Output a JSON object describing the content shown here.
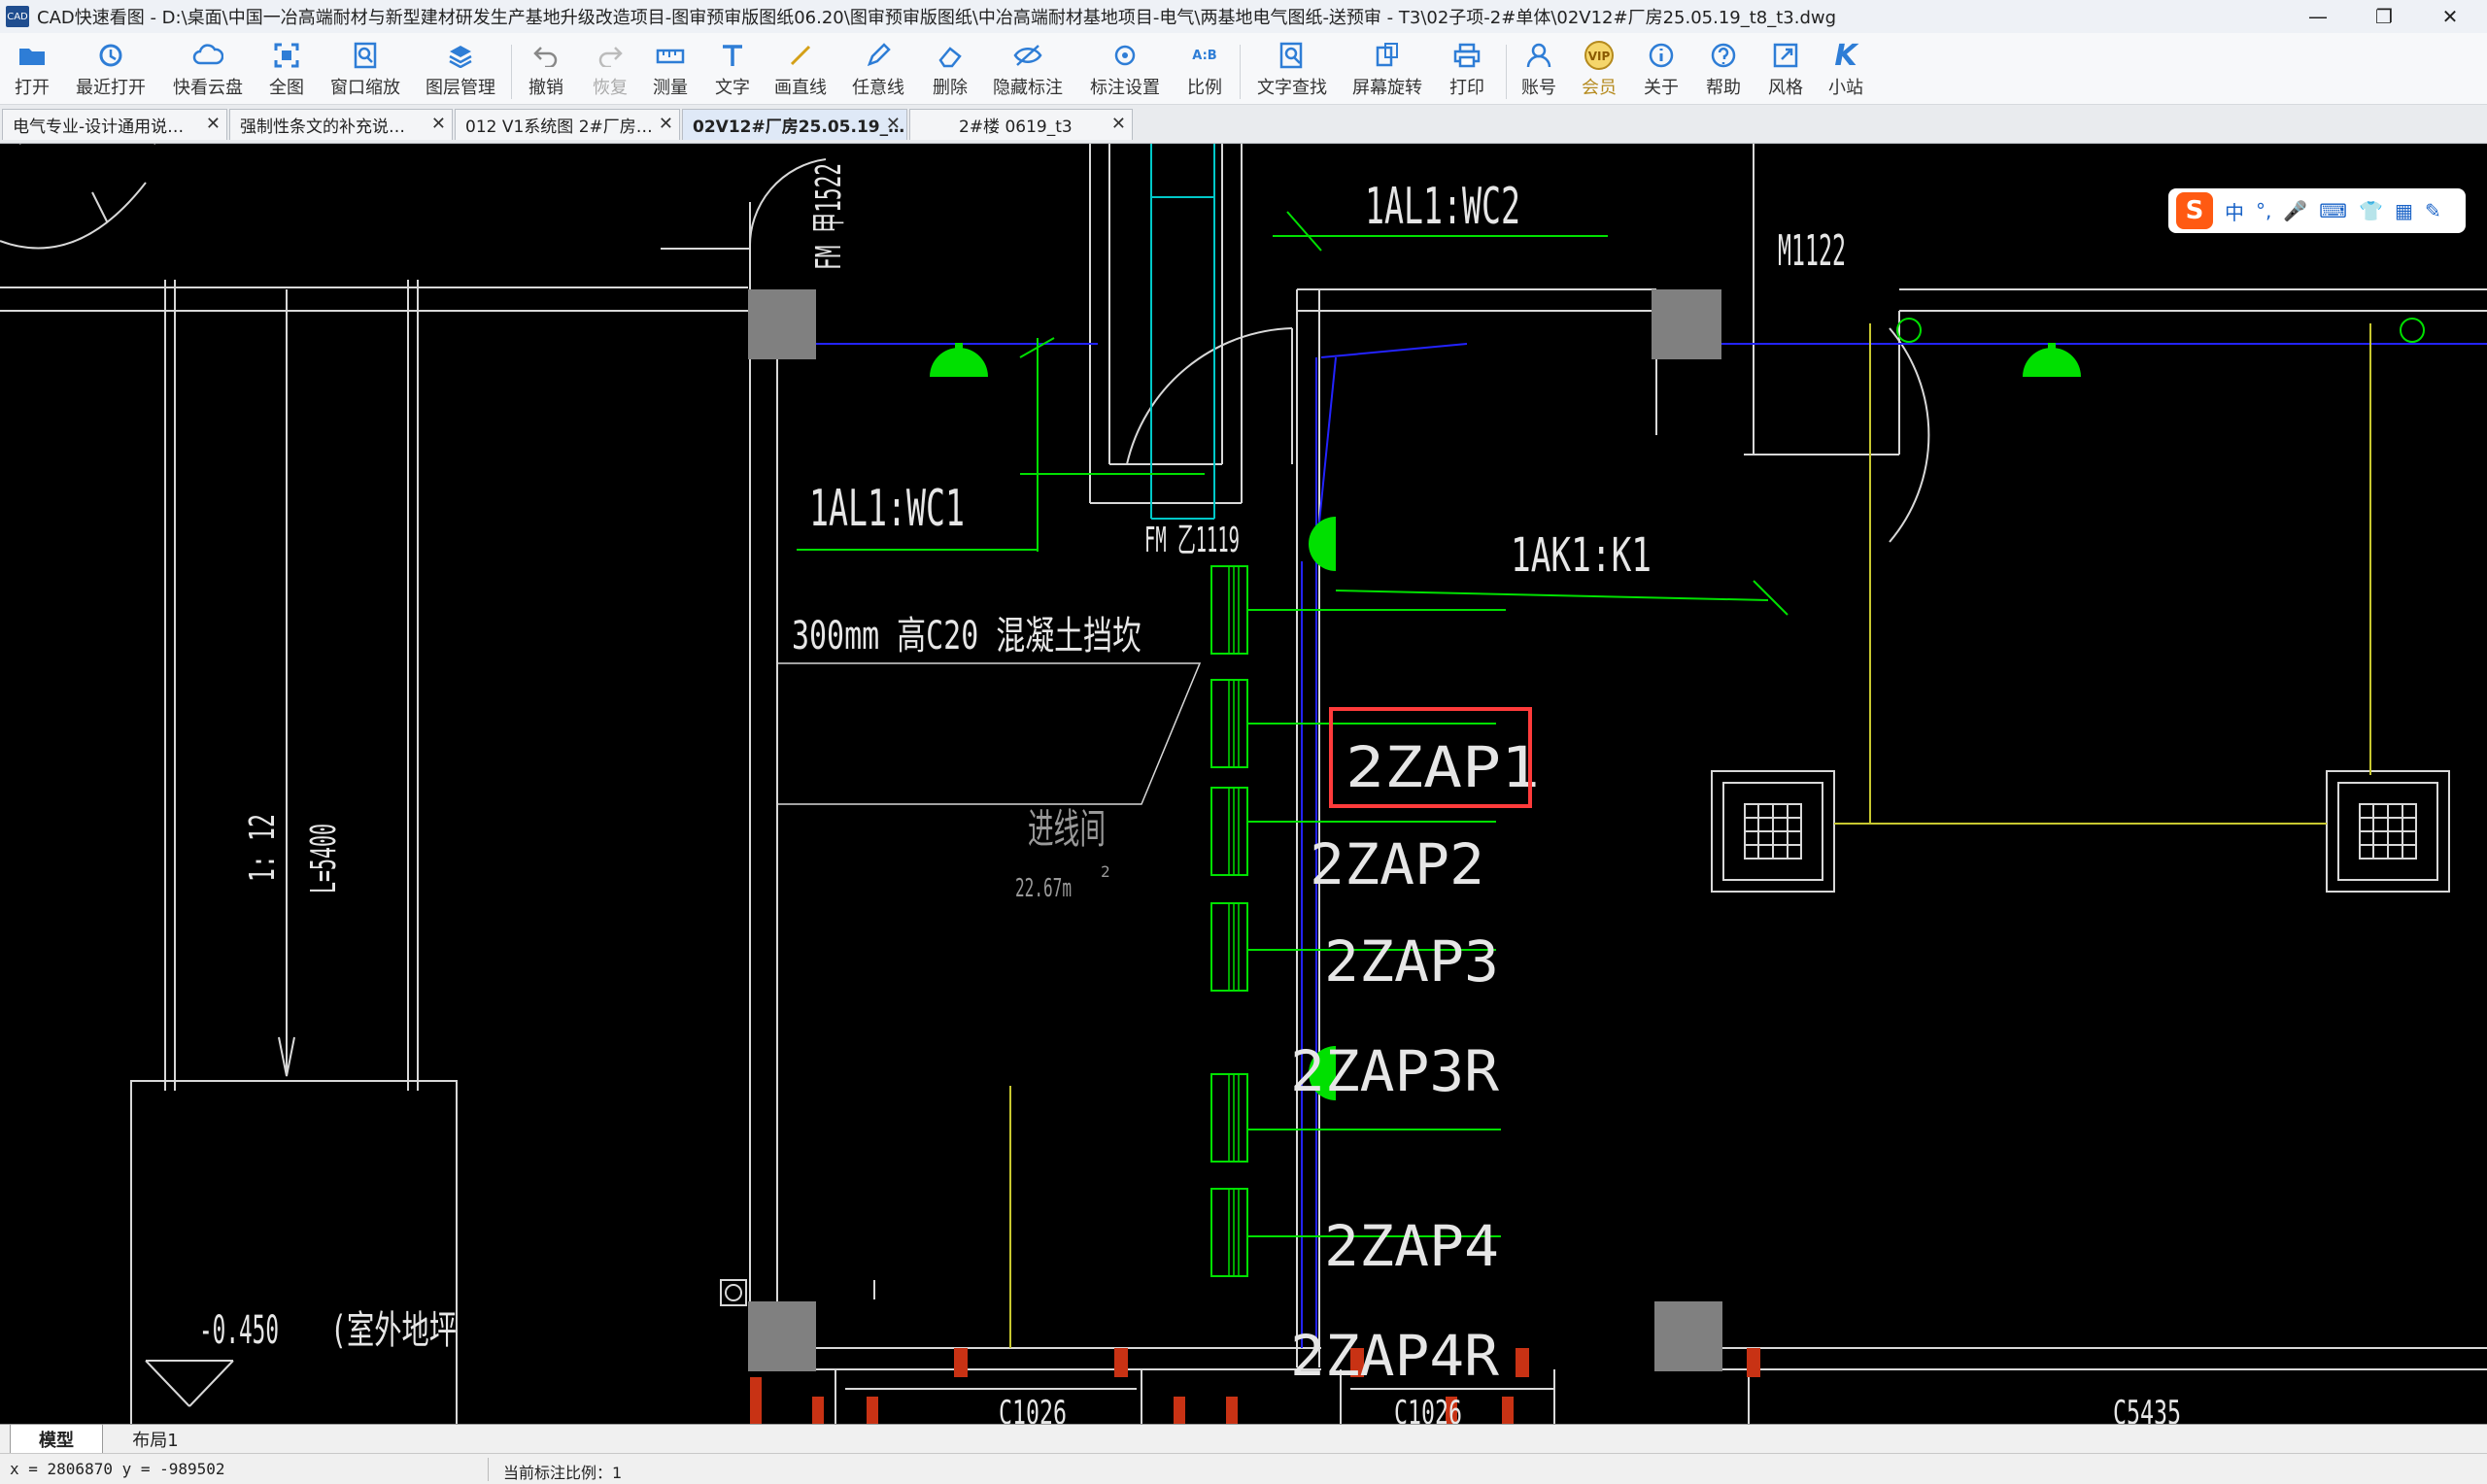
{
  "window": {
    "app_icon": "CAD",
    "title": "CAD快速看图 - D:\\桌面\\中国一冶高端耐材与新型建材研发生产基地升级改造项目-图审预审版图纸06.20\\图审预审版图纸\\中冶高端耐材基地项目-电气\\两基地电气图纸-送预审 - T3\\02子项-2#单体\\02V12#厂房25.05.19_t8_t3.dwg",
    "minimize": "—",
    "maximize": "❐",
    "close": "✕"
  },
  "toolbar": {
    "open": "打开",
    "recent": "最近打开",
    "cloud": "快看云盘",
    "fit_all": "全图",
    "window_zoom": "窗口缩放",
    "layers": "图层管理",
    "undo": "撤销",
    "redo": "恢复",
    "measure": "测量",
    "text": "文字",
    "line": "画直线",
    "freeline": "任意线",
    "delete": "删除",
    "hide_annot": "隐藏标注",
    "annot_settings": "标注设置",
    "scale": "比例",
    "text_search": "文字查找",
    "rotate": "屏幕旋转",
    "print": "打印",
    "account": "账号",
    "vip": "会员",
    "about": "关于",
    "help": "帮助",
    "style": "风格",
    "station": "小站",
    "vip_badge": "VIP",
    "scale_icon": "A:B"
  },
  "tabs": [
    {
      "label": "电气专业-设计通用说…",
      "active": false
    },
    {
      "label": "强制性条文的补充说…",
      "active": false
    },
    {
      "label": "012 V1系统图 2#厂房…",
      "active": false
    },
    {
      "label": "02V12#厂房25.05.19_…",
      "active": true
    },
    {
      "label": "2#楼 0619_t3",
      "active": false
    }
  ],
  "drawing": {
    "labels": {
      "wc2": "1AL1:WC2",
      "wc1": "1AL1:WC1",
      "k1": "1AK1:K1",
      "m1122": "M1122",
      "fm_fm1522": "FM 甲1522",
      "fm_c1119": "FM 乙1119",
      "wall_note": "300mm  高C20  混凝土挡坎",
      "room_name": "进线间",
      "room_area": "22.67m",
      "room_area_sup": "2",
      "slope": "1: 12",
      "length": "L=5400",
      "level": "-0.450",
      "outdoor": "(室外地坪",
      "c1026a": "C1026",
      "c1026b": "C1026",
      "c5435": "C5435"
    },
    "panels": [
      "2ZAP1",
      "2ZAP2",
      "2ZAP3",
      "2ZAP3R",
      "2ZAP4",
      "2ZAP4R"
    ],
    "colors": {
      "background": "#000000",
      "wall": "#e0e0e0",
      "column": "#808080",
      "green": "#00e000",
      "blue": "#2323ff",
      "yellow": "#c8c830",
      "cyan": "#00c8c8",
      "red": "#c83214",
      "highlight": "#ff3b3b"
    }
  },
  "ime": {
    "logo": "S",
    "items": [
      "中",
      "°,",
      "🎤",
      "⌨",
      "👕",
      "▦",
      "✎"
    ]
  },
  "layout_tabs": [
    {
      "label": "模型",
      "active": true
    },
    {
      "label": "布局1",
      "active": false
    }
  ],
  "status": {
    "coords": "x = 2806870  y = -989502",
    "scale": "当前标注比例：1"
  }
}
